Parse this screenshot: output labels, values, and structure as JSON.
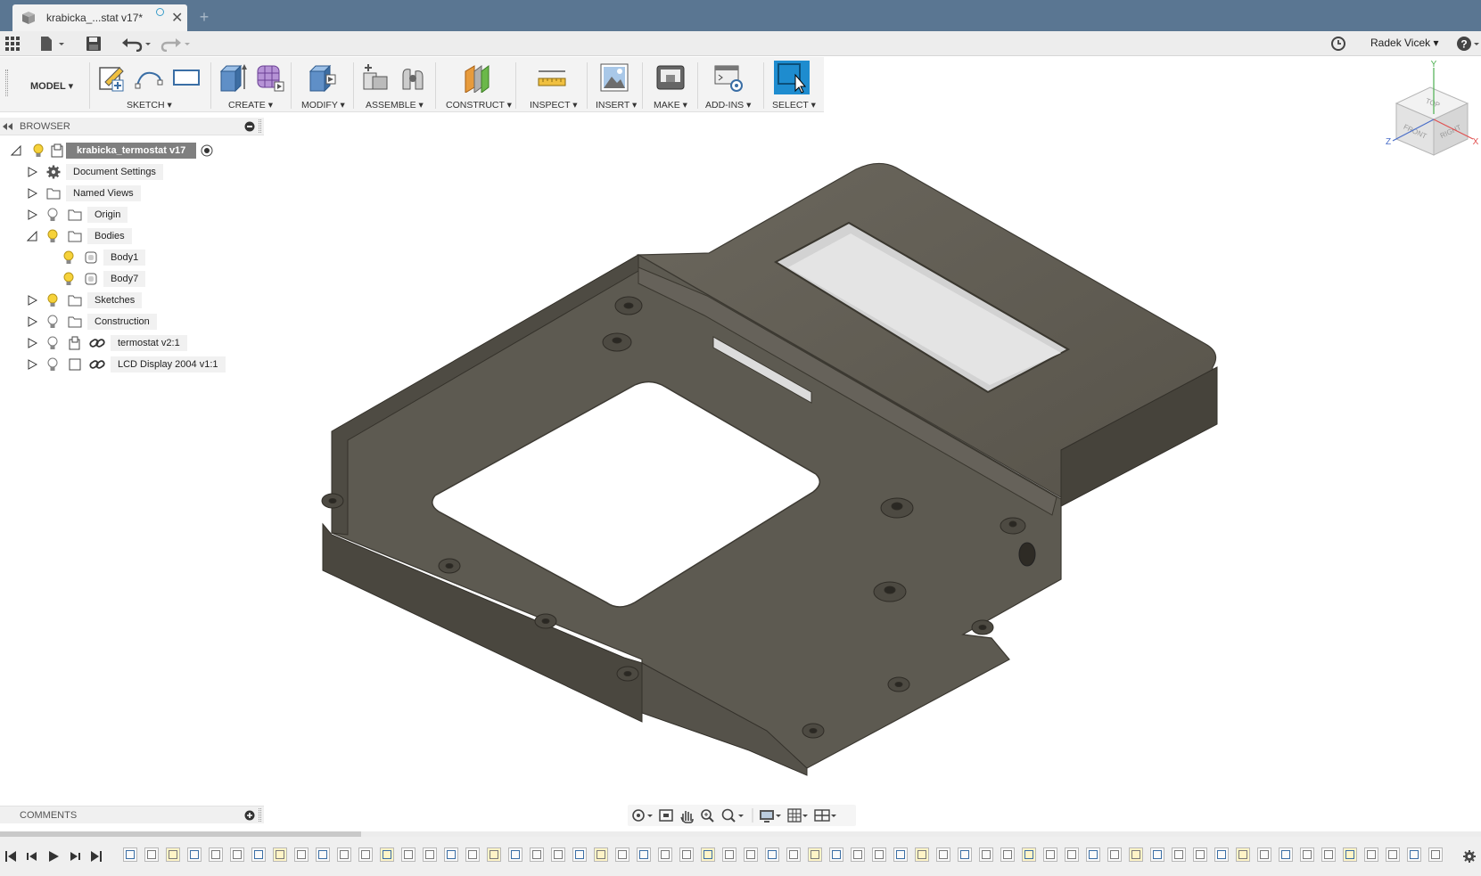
{
  "document": {
    "tab_title": "krabicka_...stat v17*",
    "close_symbol": "✕",
    "new_tab_symbol": "+"
  },
  "quick_access": {
    "icons": [
      "apps-grid-icon",
      "file-menu-icon",
      "save-icon",
      "undo-icon",
      "redo-icon",
      "job-status-icon",
      "help-icon"
    ],
    "user_name": "Radek Vicek ▾"
  },
  "ribbon": {
    "workspace": "MODEL ▾",
    "groups": [
      {
        "label": "SKETCH ▾"
      },
      {
        "label": "CREATE ▾"
      },
      {
        "label": "MODIFY ▾"
      },
      {
        "label": "ASSEMBLE ▾"
      },
      {
        "label": "CONSTRUCT ▾"
      },
      {
        "label": "INSPECT ▾"
      },
      {
        "label": "INSERT ▾"
      },
      {
        "label": "MAKE ▾"
      },
      {
        "label": "ADD-INS ▾"
      },
      {
        "label": "SELECT ▾"
      }
    ],
    "accent": "#1e8ccf"
  },
  "browser": {
    "title": "BROWSER",
    "root": "krabicka_termostat v17",
    "items": [
      {
        "label": "Document Settings",
        "icon": "gear-icon"
      },
      {
        "label": "Named Views",
        "icon": "folder-icon"
      },
      {
        "label": "Origin",
        "icon": "folder-icon"
      },
      {
        "label": "Bodies",
        "icon": "folder-icon"
      },
      {
        "label": "Body1",
        "icon": "body-icon"
      },
      {
        "label": "Body7",
        "icon": "body-icon"
      },
      {
        "label": "Sketches",
        "icon": "folder-icon"
      },
      {
        "label": "Construction",
        "icon": "folder-icon"
      },
      {
        "label": "termostat v2:1",
        "icon": "link-icon"
      },
      {
        "label": "LCD Display 2004 v1:1",
        "icon": "link-icon"
      }
    ]
  },
  "viewcube": {
    "faces": [
      "TOP",
      "FRONT",
      "RIGHT"
    ],
    "axes": [
      "X",
      "Y",
      "Z"
    ],
    "axis_colors": {
      "x": "#e05050",
      "y": "#4caf50",
      "z": "#4a6ec8"
    }
  },
  "comments": {
    "title": "COMMENTS"
  },
  "model": {
    "body_color": "#5b5850"
  }
}
